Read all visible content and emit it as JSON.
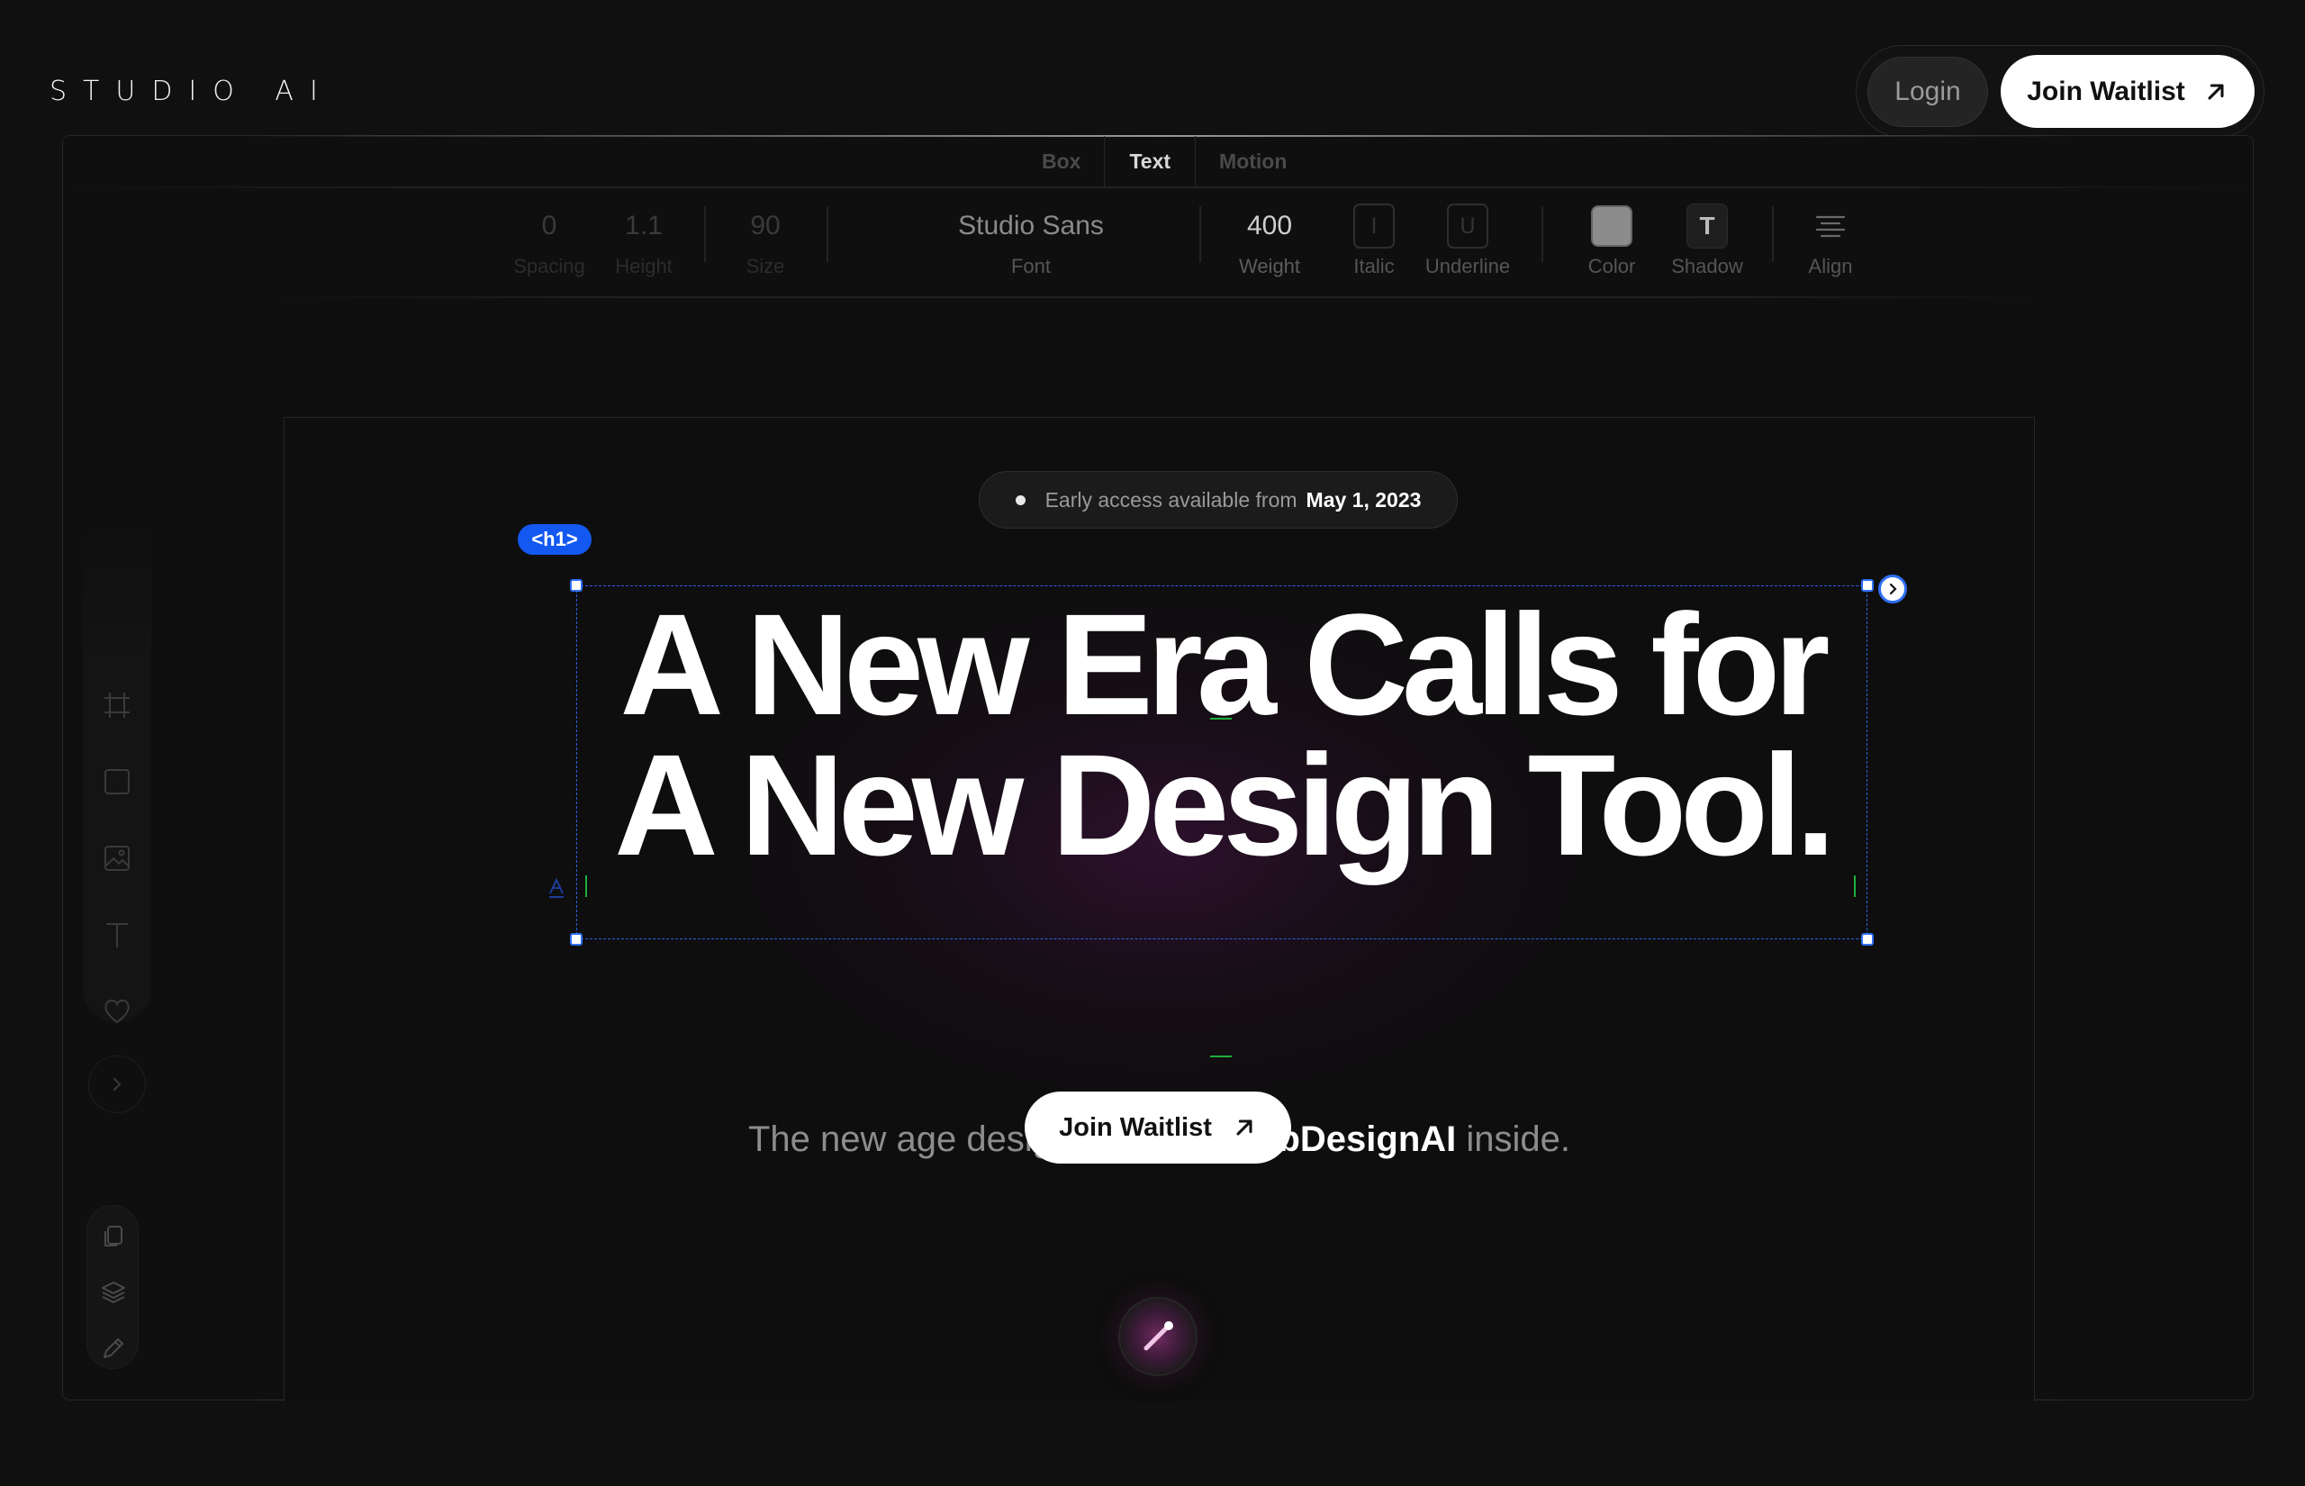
{
  "header": {
    "logo": "STUDIO AI",
    "login_label": "Login",
    "waitlist_label": "Join Waitlist"
  },
  "editor": {
    "tabs": [
      {
        "label": "Box",
        "active": false
      },
      {
        "label": "Text",
        "active": true
      },
      {
        "label": "Motion",
        "active": false
      }
    ],
    "props": {
      "spacing": {
        "value": "0",
        "label": "Spacing"
      },
      "height": {
        "value": "1.1",
        "label": "Height"
      },
      "size": {
        "value": "90",
        "label": "Size"
      },
      "font": {
        "value": "Studio Sans",
        "label": "Font"
      },
      "weight": {
        "value": "400",
        "label": "Weight"
      },
      "italic": {
        "glyph": "I",
        "label": "Italic"
      },
      "underline": {
        "glyph": "U",
        "label": "Underline"
      },
      "color": {
        "label": "Color",
        "swatch": "#8c8c8c"
      },
      "shadow": {
        "glyph": "T",
        "label": "Shadow"
      },
      "align": {
        "label": "Align"
      }
    },
    "left_tools": [
      "frame-icon",
      "rectangle-icon",
      "image-icon",
      "text-icon",
      "heart-icon",
      "chevron-right-icon"
    ],
    "bottom_tools": [
      "pages-icon",
      "layers-icon",
      "pencil-icon"
    ]
  },
  "canvas": {
    "badge": {
      "prefix": "Early access available from",
      "date": "May 1, 2023"
    },
    "selected_tag": "<h1>",
    "headline_line1": "A New Era Calls for",
    "headline_line2": "A New Design Tool.",
    "subline_prefix": "The new age design tool with",
    "subline_brand": "WebDesignAI",
    "subline_suffix": "inside.",
    "cta_label": "Join Waitlist"
  },
  "colors": {
    "background": "#101010",
    "selection": "#1358f0",
    "guide": "#1fae3c",
    "accent_glow": "#6e2a60"
  }
}
